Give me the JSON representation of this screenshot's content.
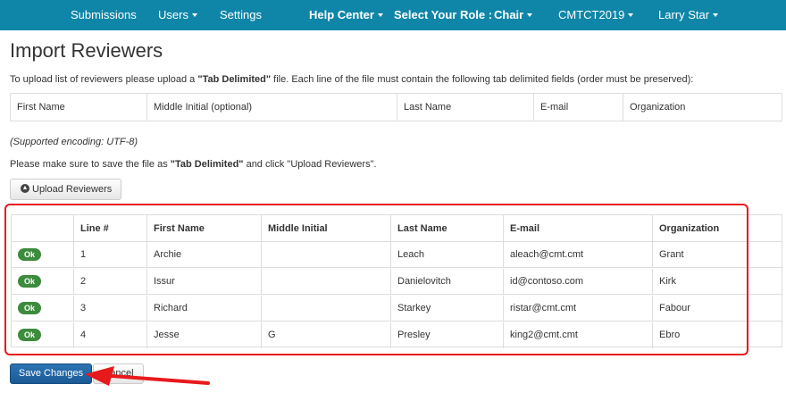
{
  "nav": {
    "submissions": "Submissions",
    "users": "Users",
    "settings": "Settings",
    "help_center": "Help Center",
    "role_label": "Select Your Role :",
    "role_value": "Chair",
    "conference": "CMTCT2019",
    "user": "Larry Star"
  },
  "page_title": "Import Reviewers",
  "instructions": {
    "pre": "To upload list of reviewers please upload a ",
    "bold": "\"Tab Delimited\"",
    "post": " file. Each line of the file must contain the following tab delimited fields (order must be preserved):"
  },
  "fields": [
    "First Name",
    "Middle Initial (optional)",
    "Last Name",
    "E-mail",
    "Organization"
  ],
  "encoding_note": "(Supported encoding: UTF-8)",
  "save_note": {
    "pre": "Please make sure to save the file as ",
    "bold": "\"Tab Delimited\"",
    "post": " and click \"Upload Reviewers\"."
  },
  "upload_button": "Upload Reviewers",
  "table": {
    "headers": [
      "",
      "Line #",
      "First Name",
      "Middle Initial",
      "Last Name",
      "E-mail",
      "Organization"
    ],
    "rows": [
      {
        "status": "Ok",
        "line": "1",
        "first": "Archie",
        "middle": "",
        "last": "Leach",
        "email": "aleach@cmt.cmt",
        "org": "Grant"
      },
      {
        "status": "Ok",
        "line": "2",
        "first": "Issur",
        "middle": "",
        "last": "Danielovitch",
        "email": "id@contoso.com",
        "org": "Kirk"
      },
      {
        "status": "Ok",
        "line": "3",
        "first": "Richard",
        "middle": "",
        "last": "Starkey",
        "email": "ristar@cmt.cmt",
        "org": "Fabour"
      },
      {
        "status": "Ok",
        "line": "4",
        "first": "Jesse",
        "middle": "G",
        "last": "Presley",
        "email": "king2@cmt.cmt",
        "org": "Ebro"
      }
    ]
  },
  "save_button": "Save Changes",
  "cancel_button": "Cancel",
  "colors": {
    "navbar": "#0f86a8",
    "ok_badge": "#3d8b3d",
    "primary_button": "#1f64a3",
    "highlight": "#e8191b"
  }
}
